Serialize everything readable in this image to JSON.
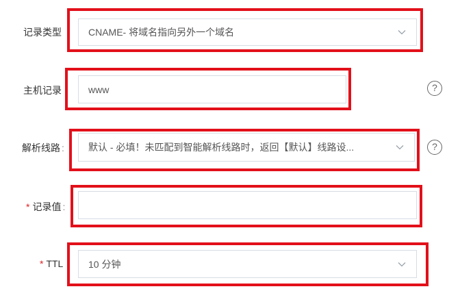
{
  "form": {
    "record_type": {
      "label": "记录类型",
      "value": "CNAME- 将域名指向另外一个域名"
    },
    "host_record": {
      "label": "主机记录",
      "label_suffix": ":",
      "value": "www"
    },
    "resolution_line": {
      "label": "解析线路",
      "label_suffix": ":",
      "value": "默认 - 必填！未匹配到智能解析线路时，返回【默认】线路设..."
    },
    "record_value": {
      "required_mark": "*",
      "label": "记录值",
      "label_suffix": ":",
      "value": ""
    },
    "ttl": {
      "required_mark": "*",
      "label": "TTL",
      "value": "10 分钟"
    },
    "help_glyph": "?"
  },
  "colors": {
    "highlight": "#e2101a",
    "required": "#e02020",
    "border": "#d7dde4"
  },
  "icons": [
    "chevron-down-icon",
    "question-circle-icon"
  ]
}
